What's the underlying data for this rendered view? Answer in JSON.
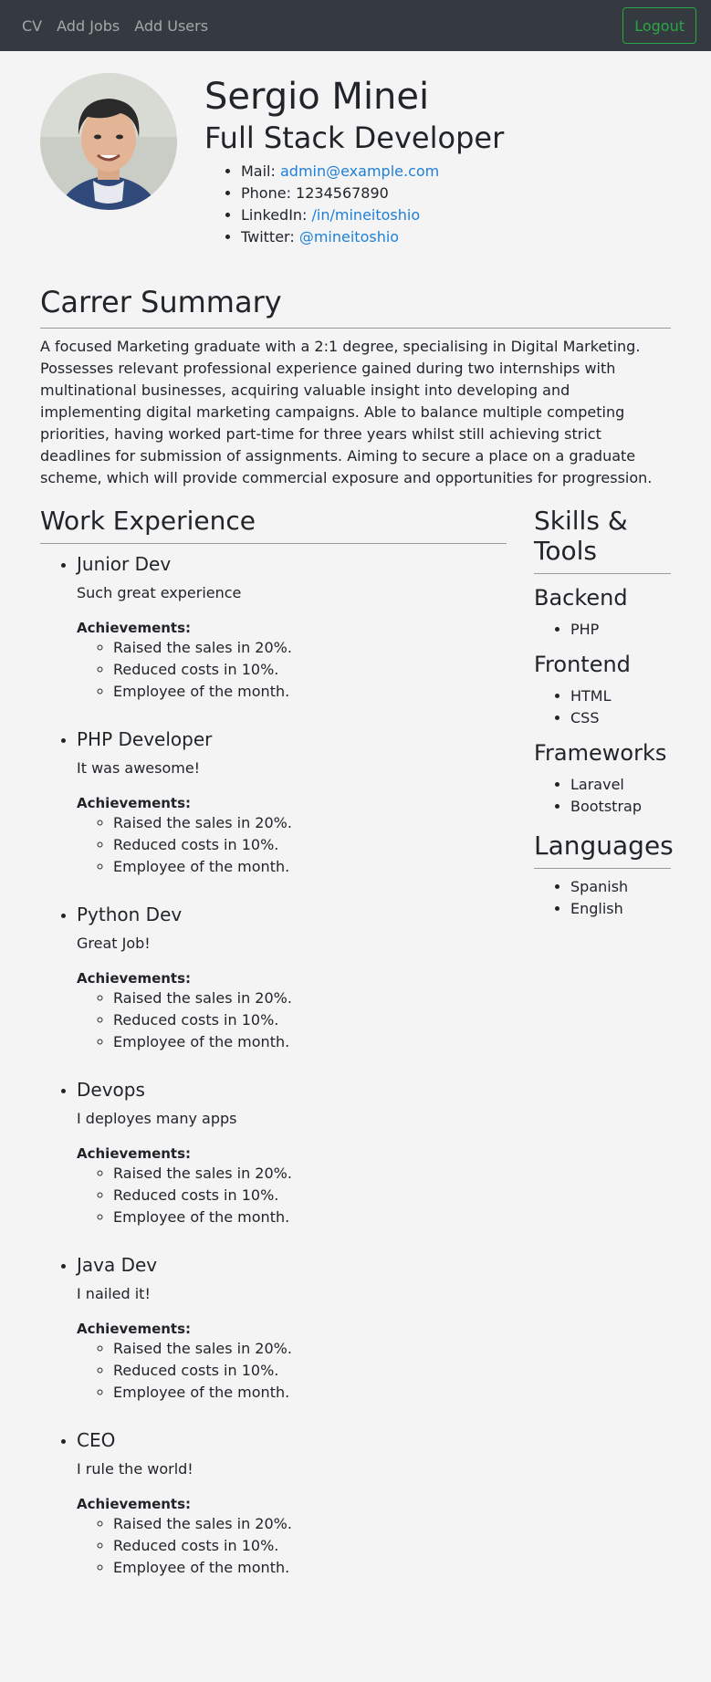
{
  "nav": {
    "links": [
      "CV",
      "Add Jobs",
      "Add Users"
    ],
    "logout_label": "Logout"
  },
  "profile": {
    "name": "Sergio Minei",
    "title": "Full Stack Developer",
    "contacts": [
      {
        "label": "Mail: ",
        "value": "admin@example.com",
        "is_link": true
      },
      {
        "label": "Phone: ",
        "value": "1234567890",
        "is_link": false
      },
      {
        "label": "LinkedIn: ",
        "value": "/in/mineitoshio",
        "is_link": true
      },
      {
        "label": "Twitter: ",
        "value": "@mineitoshio",
        "is_link": true
      }
    ]
  },
  "summary": {
    "heading": "Carrer Summary",
    "text": "A focused Marketing graduate with a 2:1 degree, specialising in Digital Marketing. Possesses relevant professional experience gained during two internships with multinational businesses, acquiring valuable insight into developing and implementing digital marketing campaigns. Able to balance multiple competing priorities, having worked part-time for three years whilst still achieving strict deadlines for submission of assignments. Aiming to secure a place on a graduate scheme, which will provide commercial exposure and opportunities for progression."
  },
  "work": {
    "heading": "Work Experience",
    "achievements_label": "Achievements:",
    "jobs": [
      {
        "title": "Junior Dev",
        "description": "Such great experience",
        "achievements": [
          "Raised the sales in 20%.",
          "Reduced costs in 10%.",
          "Employee of the month."
        ]
      },
      {
        "title": "PHP Developer",
        "description": "It was awesome!",
        "achievements": [
          "Raised the sales in 20%.",
          "Reduced costs in 10%.",
          "Employee of the month."
        ]
      },
      {
        "title": "Python Dev",
        "description": "Great Job!",
        "achievements": [
          "Raised the sales in 20%.",
          "Reduced costs in 10%.",
          "Employee of the month."
        ]
      },
      {
        "title": "Devops",
        "description": "I deployes many apps",
        "achievements": [
          "Raised the sales in 20%.",
          "Reduced costs in 10%.",
          "Employee of the month."
        ]
      },
      {
        "title": "Java Dev",
        "description": "I nailed it!",
        "achievements": [
          "Raised the sales in 20%.",
          "Reduced costs in 10%.",
          "Employee of the month."
        ]
      },
      {
        "title": "CEO",
        "description": "I rule the world!",
        "achievements": [
          "Raised the sales in 20%.",
          "Reduced costs in 10%.",
          "Employee of the month."
        ]
      }
    ]
  },
  "skills": {
    "heading": "Skills & Tools",
    "groups": [
      {
        "title": "Backend",
        "items": [
          "PHP"
        ]
      },
      {
        "title": "Frontend",
        "items": [
          "HTML",
          "CSS"
        ]
      },
      {
        "title": "Frameworks",
        "items": [
          "Laravel",
          "Bootstrap"
        ]
      }
    ]
  },
  "languages": {
    "heading": "Languages",
    "items": [
      "Spanish",
      "English"
    ]
  },
  "colors": {
    "navbar": "#343a40",
    "logout": "#28a745",
    "link": "#1e7fd6",
    "background": "#f4f4f5"
  }
}
